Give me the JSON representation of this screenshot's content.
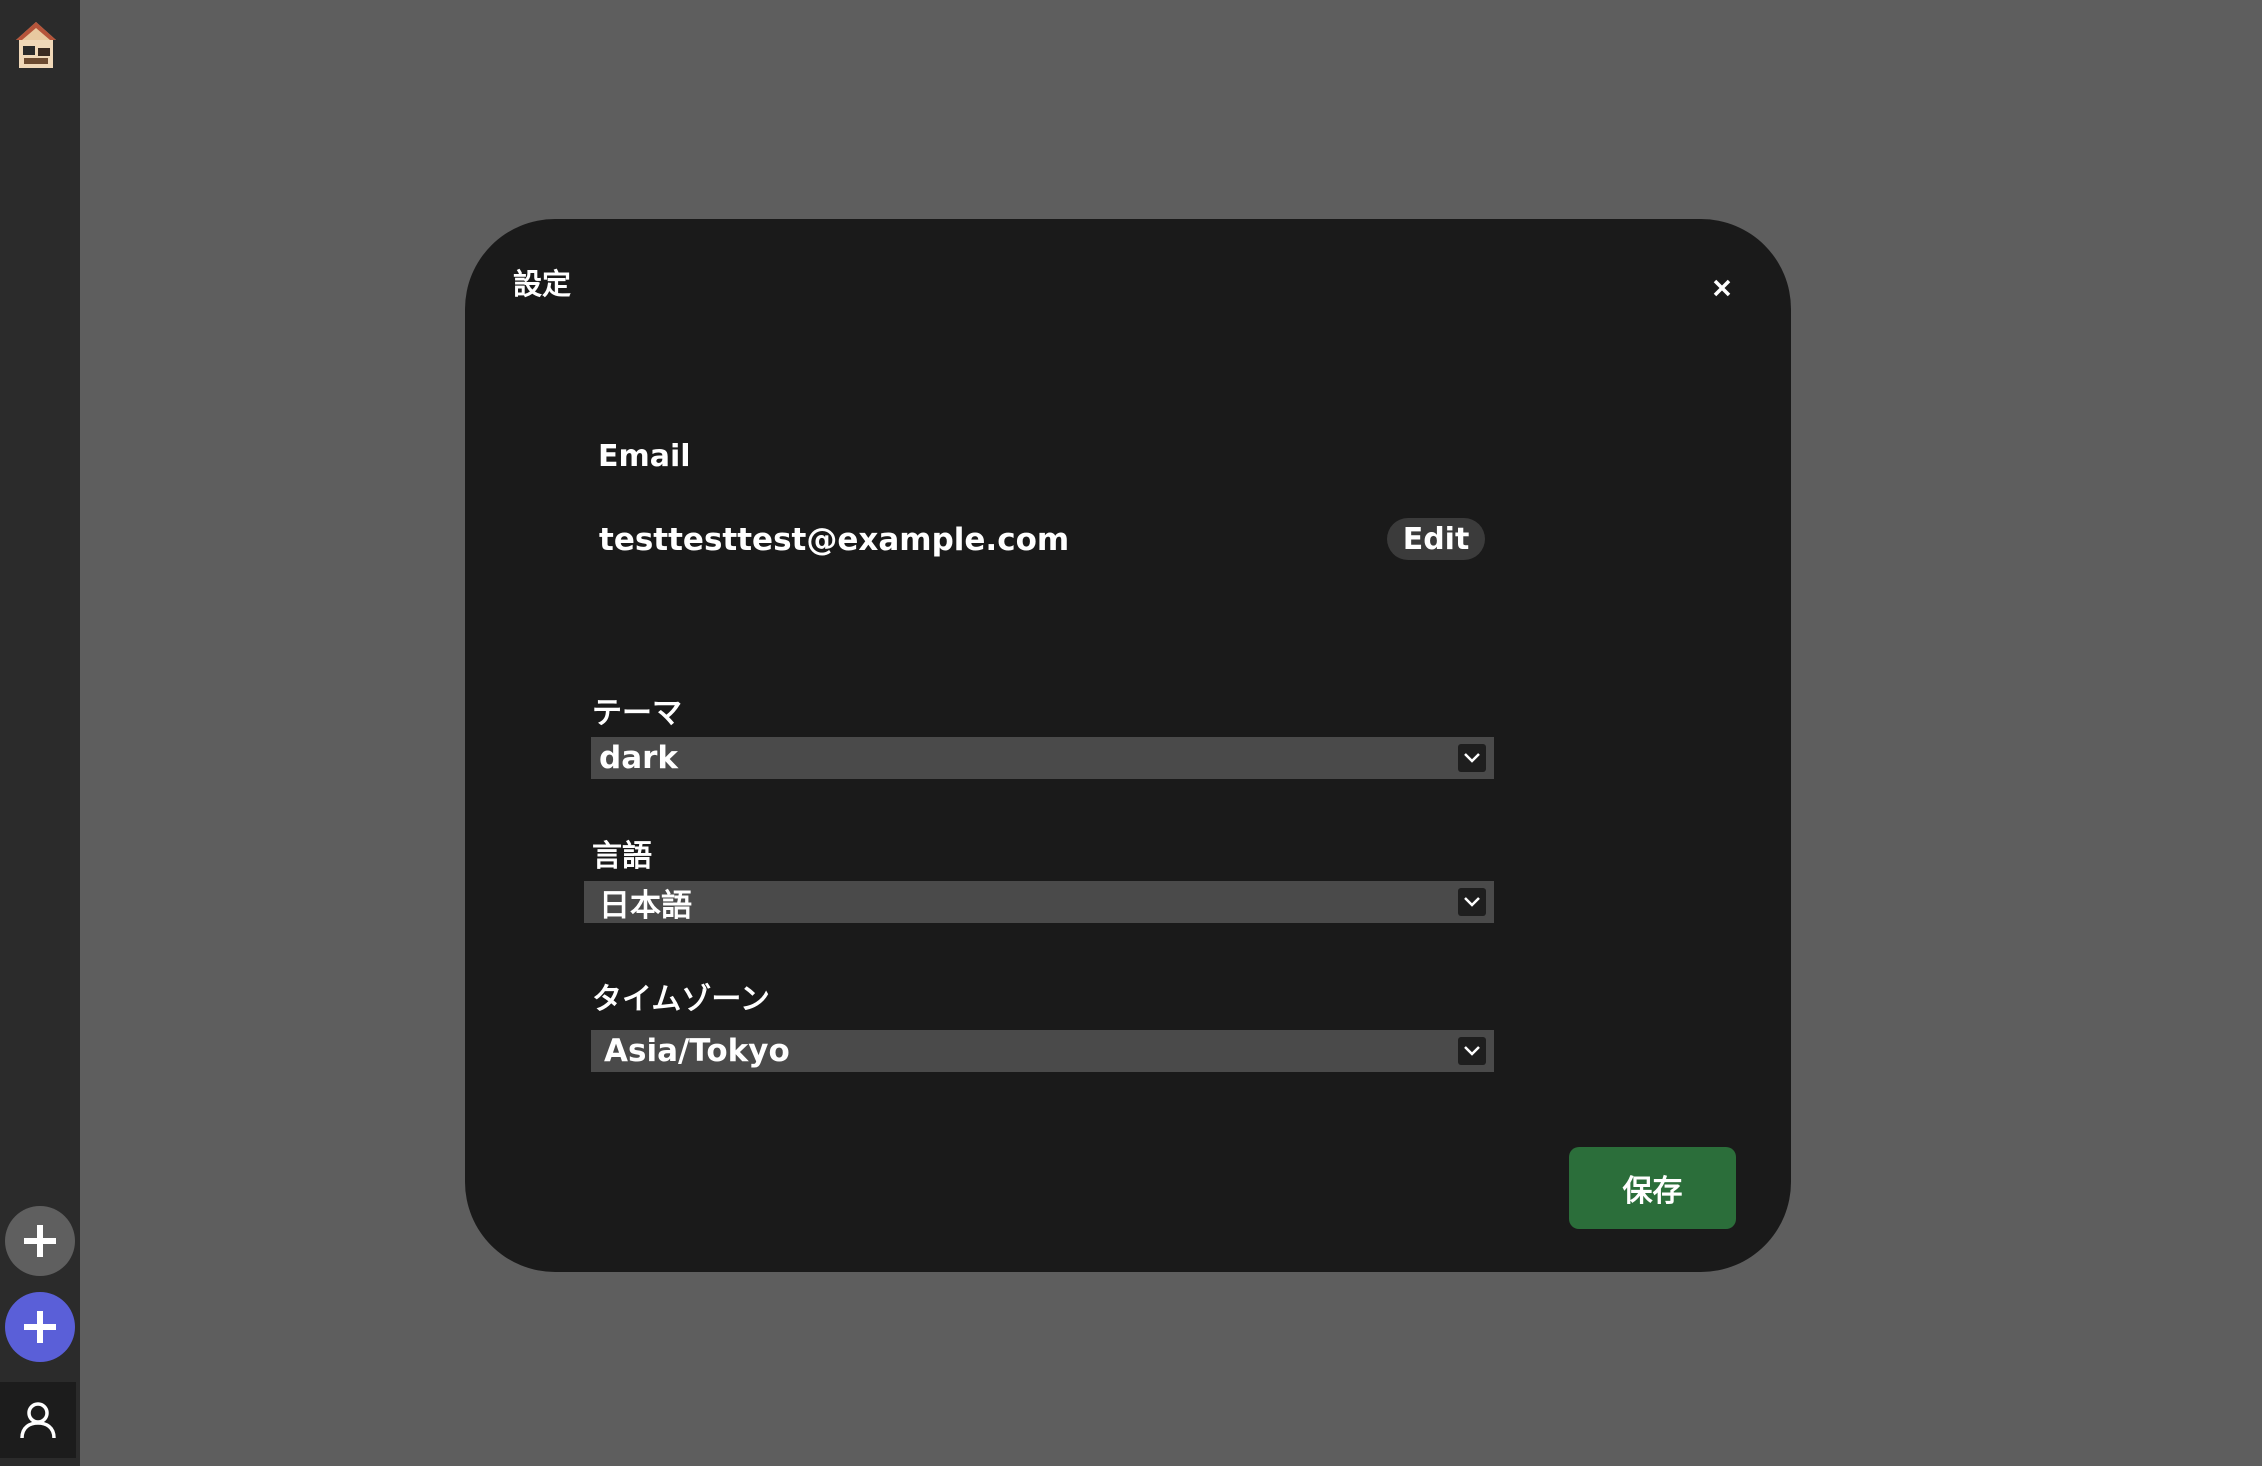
{
  "sidebar": {
    "logo_icon": "house-avatar-icon",
    "add_button_icon": "plus-icon",
    "add_button_2_icon": "plus-icon",
    "user_icon": "user-icon"
  },
  "modal": {
    "title": "設定",
    "close_label": "×",
    "email": {
      "label": "Email",
      "value": "testtesttest@example.com",
      "edit_label": "Edit"
    },
    "theme": {
      "label": "テーマ",
      "selected": "dark"
    },
    "language": {
      "label": "言語",
      "selected": "日本語"
    },
    "timezone": {
      "label": "タイムゾーン",
      "selected": "Asia/Tokyo"
    },
    "save_label": "保存"
  },
  "colors": {
    "backdrop": "#5e5e5e",
    "sidebar": "#2b2b2b",
    "modal_bg": "#1a1a1a",
    "select_bg": "#4a4a4a",
    "save_button": "#2b6e3a",
    "accent_blue": "#5a5fd8"
  }
}
